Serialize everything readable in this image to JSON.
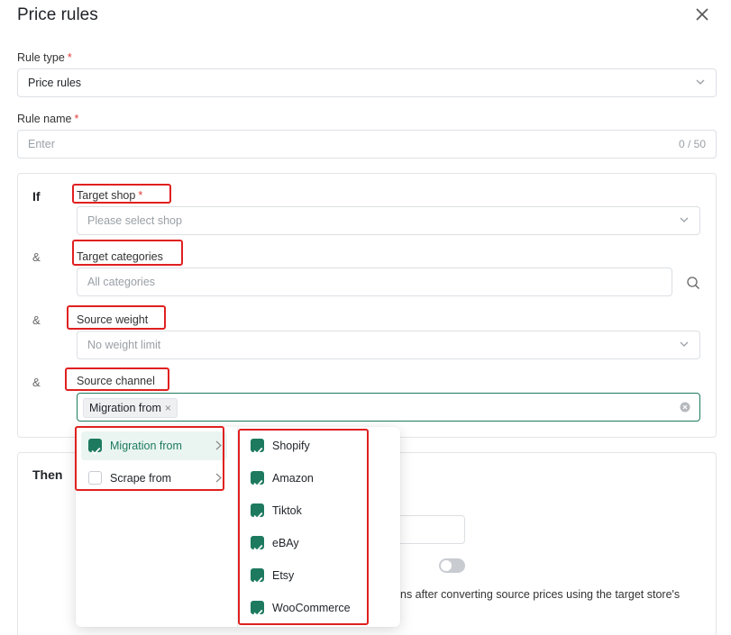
{
  "header": {
    "title": "Price rules"
  },
  "form": {
    "rule_type": {
      "label": "Rule type",
      "required_mark": "*",
      "value": "Price rules"
    },
    "rule_name": {
      "label": "Rule name",
      "required_mark": "*",
      "placeholder": "Enter",
      "counter": "0 / 50"
    }
  },
  "if_section": {
    "if_label": "If",
    "amp": "&",
    "target_shop": {
      "label": "Target shop",
      "required_mark": "*",
      "placeholder": "Please select shop"
    },
    "target_categories": {
      "label": "Target categories",
      "placeholder": "All categories"
    },
    "source_weight": {
      "label": "Source weight",
      "placeholder": "No weight limit"
    },
    "source_channel": {
      "label": "Source channel",
      "tag": "Migration from",
      "tag_remove": "×"
    }
  },
  "then_section": {
    "then_label": "Then",
    "description_partial": "ns after converting source prices using the target store's"
  },
  "dropdown": {
    "groups": [
      {
        "label": "Migration from",
        "checked": true,
        "active": true
      },
      {
        "label": "Scrape from",
        "checked": false,
        "active": false
      }
    ],
    "channels": [
      {
        "label": "Shopify",
        "checked": true
      },
      {
        "label": "Amazon",
        "checked": true
      },
      {
        "label": "Tiktok",
        "checked": true
      },
      {
        "label": "eBAy",
        "checked": true
      },
      {
        "label": "Etsy",
        "checked": true
      },
      {
        "label": "WooCommerce",
        "checked": true
      }
    ]
  },
  "colors": {
    "accent": "#1d7a5f",
    "highlight": "#e02020",
    "required": "#e23b3b"
  }
}
